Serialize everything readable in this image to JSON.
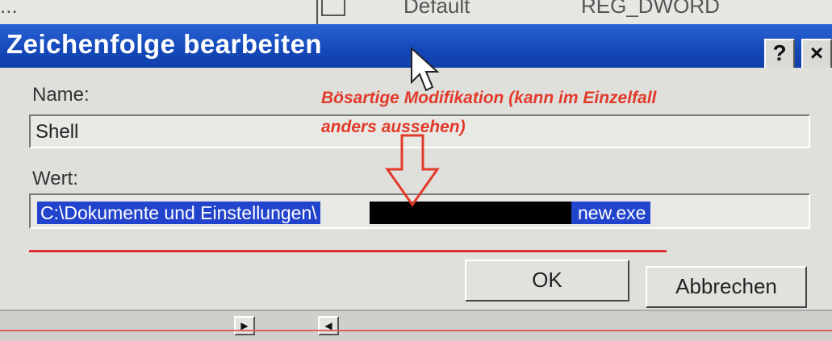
{
  "background": {
    "col1": "...",
    "col2": "Default",
    "col3": "REG_DWORD"
  },
  "dialog": {
    "title": "Zeichenfolge bearbeiten",
    "help_label": "?",
    "close_label": "×",
    "name_label": "Name:",
    "name_value": "Shell",
    "value_label": "Wert:",
    "value_prefix": "C:\\Dokumente und Einstellungen\\",
    "value_suffix": "new.exe",
    "ok_label": "OK",
    "cancel_label": "Abbrechen"
  },
  "annotation": {
    "line1": "Bösartige Modifikation (kann im Einzelfall",
    "line2": "anders aussehen)",
    "color": "#e23a2a"
  },
  "scroll": {
    "right_arrow": "▶",
    "left_arrow": "◀"
  },
  "colors": {
    "titlebar": "#1447b8",
    "selection": "#2244cc"
  }
}
